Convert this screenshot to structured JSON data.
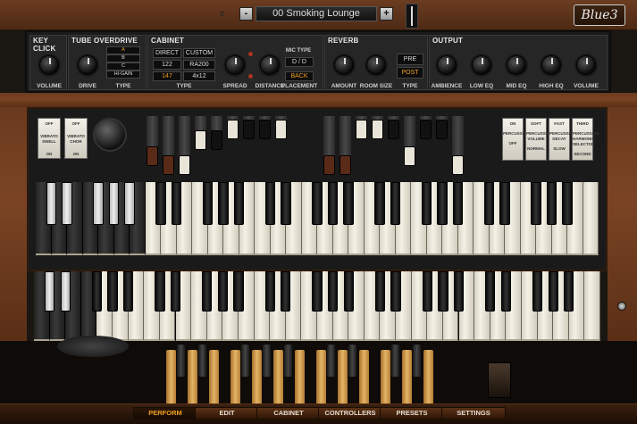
{
  "header": {
    "preset_prefix": "e",
    "prev_label": "-",
    "next_label": "+",
    "preset_name": "00 Smoking Lounge",
    "logo": "Blue3"
  },
  "fx": {
    "key_click": {
      "title": "KEY CLICK",
      "volume_label": "VOLUME"
    },
    "tube": {
      "title": "TUBE OVERDRIVE",
      "drive_label": "DRIVE",
      "type_label": "TYPE",
      "types": [
        "A",
        "B",
        "C",
        "HI-GAIN"
      ],
      "selected_type": "A"
    },
    "cabinet": {
      "title": "CABINET",
      "type_buttons": [
        "DIRECT",
        "CUSTOM",
        "122",
        "RA200",
        "147",
        "4x12"
      ],
      "selected_type": "147",
      "type_label": "TYPE",
      "spread_label": "SPREAD",
      "distance_label": "DISTANCE",
      "mic_type_label": "MIC TYPE",
      "mic_value": "D / D",
      "placement_value": "BACK",
      "placement_label": "PLACEMENT"
    },
    "reverb": {
      "title": "REVERB",
      "amount_label": "AMOUNT",
      "room_label": "ROOM SIZE",
      "type_label": "TYPE",
      "pre": "PRE",
      "post": "POST",
      "selected": "POST"
    },
    "output": {
      "title": "OUTPUT",
      "knobs": [
        "AMBIENCE",
        "LOW EQ",
        "MID EQ",
        "HIGH EQ",
        "VOLUME"
      ]
    }
  },
  "console": {
    "vibrato_left": {
      "top": "OFF",
      "mid": "VIBRATO SWELL",
      "bottom": "ON"
    },
    "vibrato_right": {
      "top": "OFF",
      "mid": "VIBRATO CHOR",
      "bottom": "ON"
    },
    "perc_tabs": [
      {
        "top": "ON",
        "mid": "PERCUSSION",
        "bottom": "OFF"
      },
      {
        "top": "SOFT",
        "mid": "PERCUSSION VOLUME",
        "bottom": "NORMAL"
      },
      {
        "top": "FAST",
        "mid": "PERCUSSION DECAY",
        "bottom": "SLOW"
      },
      {
        "top": "THIRD",
        "mid": "PERCUSSION HARMONIC SELECTOR",
        "bottom": "SECOND"
      }
    ]
  },
  "nav": {
    "tabs": [
      "PERFORM",
      "EDIT",
      "CABINET",
      "CONTROLLERS",
      "PRESETS",
      "SETTINGS"
    ],
    "active": "PERFORM"
  },
  "colors": {
    "accent": "#f0a020",
    "wood": "#6a3a1e",
    "panel": "#1b1b1b"
  }
}
